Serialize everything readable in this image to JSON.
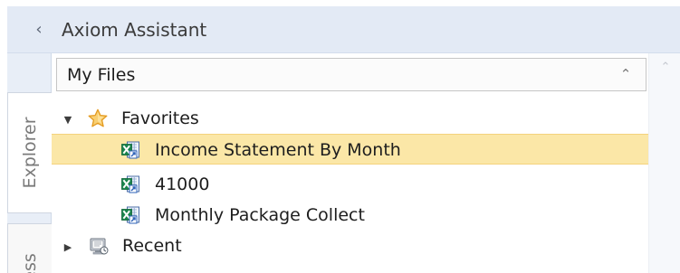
{
  "app": {
    "title": "Axiom Assistant",
    "collapse_glyph": "‹"
  },
  "rail": {
    "tabs": [
      {
        "label": "Explorer",
        "icon": "",
        "active": true
      },
      {
        "label": "ess",
        "icon": "",
        "active": false
      }
    ]
  },
  "files": {
    "dropdown_value": "My Files",
    "dropdown_chevron": "⌃",
    "scrollbar_up": "⌃"
  },
  "tree": {
    "favorites": {
      "label": "Favorites",
      "expander": "▼",
      "icon": "star-icon",
      "expanded": true
    },
    "items": [
      {
        "label": "Income Statement By Month",
        "icon": "report-shortcut-icon",
        "selected": true
      },
      {
        "label": "41000",
        "icon": "report-shortcut-icon",
        "selected": false
      },
      {
        "label": "Monthly Package Collect",
        "icon": "report-shortcut-icon",
        "selected": false
      }
    ],
    "recent": {
      "label": "Recent",
      "expander": "▶",
      "icon": "recent-files-icon",
      "expanded": false
    }
  },
  "colors": {
    "header_bg": "#e3eaf5",
    "selected_bg": "#fbe7a7",
    "selected_border": "#f4d27d",
    "star": "#f2b84b",
    "excel_green": "#19834c",
    "link_blue": "#2f63b9"
  }
}
